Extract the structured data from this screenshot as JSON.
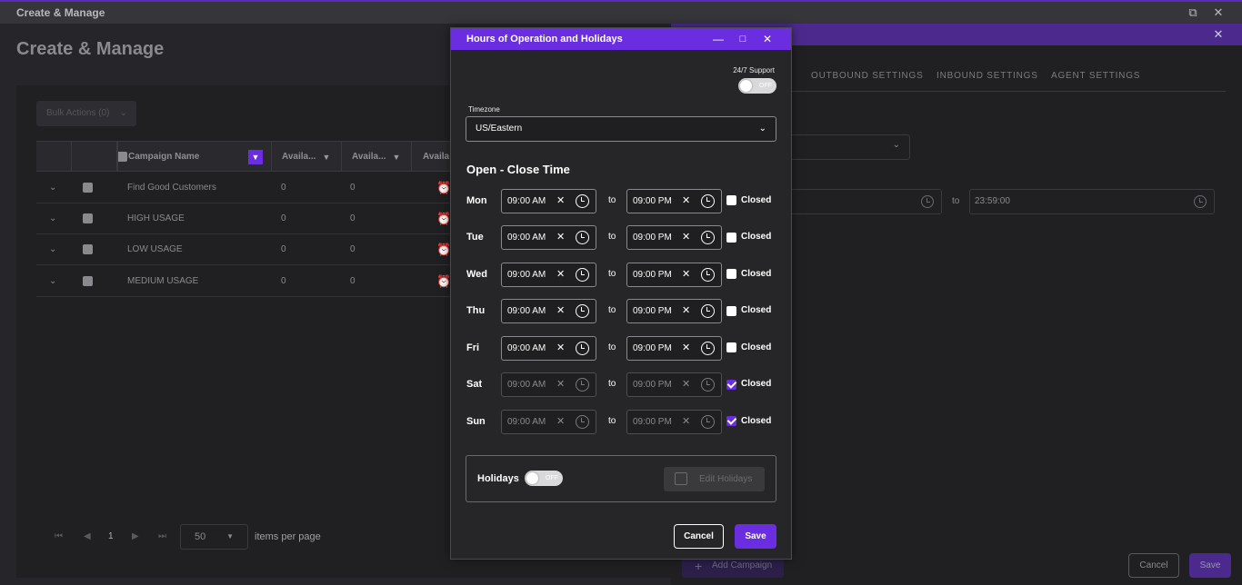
{
  "main_window": {
    "title": "Create & Manage",
    "restore_icon": "⧉",
    "close_icon": "✕",
    "heading": "Create & Manage"
  },
  "grid": {
    "bulk_actions_label": "Bulk Actions (0)",
    "columns": [
      "Campaign Name",
      "Availa...",
      "Availa...",
      "Availa"
    ],
    "rows": [
      {
        "name": "Find Good Customers",
        "a1": "0",
        "a2": "0"
      },
      {
        "name": "HIGH USAGE",
        "a1": "0",
        "a2": "0"
      },
      {
        "name": "LOW USAGE",
        "a1": "0",
        "a2": "0"
      },
      {
        "name": "MEDIUM USAGE",
        "a1": "0",
        "a2": "0"
      }
    ],
    "pager": {
      "current_page": "1",
      "per_page": "50",
      "per_page_label": "items per page"
    }
  },
  "right_panel": {
    "close_icon": "✕",
    "tabs": [
      "OUTBOUND SETTINGS",
      "INBOUND SETTINGS",
      "AGENT SETTINGS"
    ],
    "to_label": "to",
    "end_time": "23:59:00",
    "add_campaign_label": "Add Campaign",
    "cancel_label": "Cancel",
    "save_label": "Save"
  },
  "dialog": {
    "title": "Hours of Operation and Holidays",
    "minimize_icon": "—",
    "maximize_icon": "□",
    "close_icon": "✕",
    "support_label": "24/7 Support",
    "support_toggle": "OFF",
    "timezone_label": "Timezone",
    "timezone_value": "US/Eastern",
    "section_title": "Open - Close Time",
    "to_label": "to",
    "closed_label": "Closed",
    "clear_icon": "✕",
    "days": [
      {
        "day": "Mon",
        "open": "09:00 AM",
        "close": "09:00 PM",
        "closed": false
      },
      {
        "day": "Tue",
        "open": "09:00 AM",
        "close": "09:00 PM",
        "closed": false
      },
      {
        "day": "Wed",
        "open": "09:00 AM",
        "close": "09:00 PM",
        "closed": false
      },
      {
        "day": "Thu",
        "open": "09:00 AM",
        "close": "09:00 PM",
        "closed": false
      },
      {
        "day": "Fri",
        "open": "09:00 AM",
        "close": "09:00 PM",
        "closed": false
      },
      {
        "day": "Sat",
        "open": "09:00 AM",
        "close": "09:00 PM",
        "closed": true
      },
      {
        "day": "Sun",
        "open": "09:00 AM",
        "close": "09:00 PM",
        "closed": true
      }
    ],
    "holidays_label": "Holidays",
    "holidays_toggle": "OFF",
    "edit_holidays_label": "Edit Holidays",
    "cancel_label": "Cancel",
    "save_label": "Save"
  },
  "colors": {
    "accent": "#6a2ee0",
    "dialog_bg": "#262628",
    "page_bg": "#1b1b1d"
  }
}
